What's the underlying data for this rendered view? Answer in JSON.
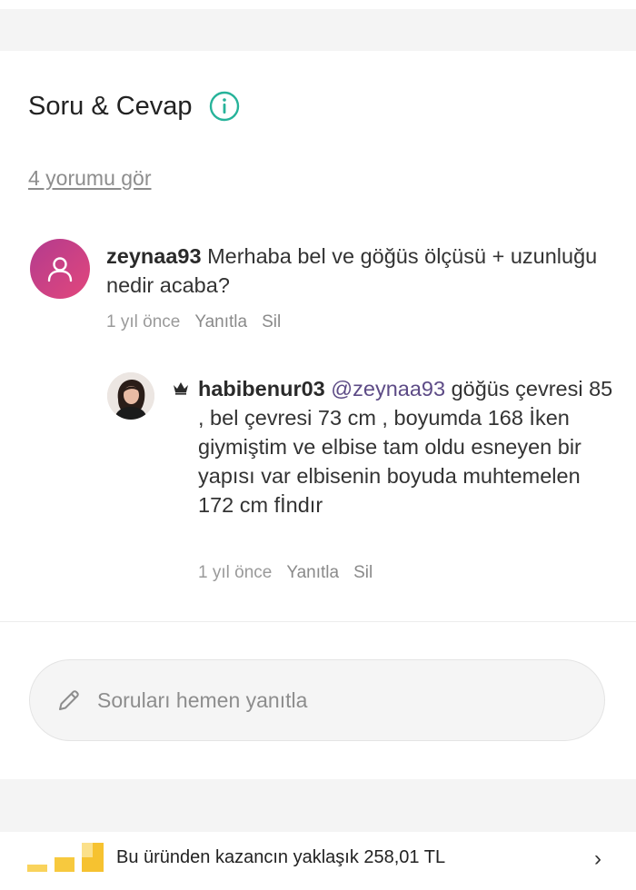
{
  "section": {
    "title": "Soru & Cevap",
    "see_all_link": "4 yorumu gör"
  },
  "comments": [
    {
      "username": "zeynaa93",
      "text": "Merhaba bel ve göğüs ölçüsü + uzunluğu nedir acaba?",
      "time": "1 yıl önce",
      "reply_label": "Yanıtla",
      "delete_label": "Sil"
    },
    {
      "username": "habibenur03",
      "mention": "@zeynaa93",
      "text": "göğüs çevresi 85 , bel çevresi 73 cm , boyumda 168 İken giymiştim ve elbise tam oldu esneyen bir yapısı var elbisenin boyuda muhtemelen 172 cm fİndır",
      "time": "1 yıl önce",
      "reply_label": "Yanıtla",
      "delete_label": "Sil",
      "badge_icon": "crown-icon"
    }
  ],
  "reply_input": {
    "placeholder": "Soruları hemen yanıtla",
    "icon": "pencil-icon"
  },
  "earnings": {
    "text": "Bu üründen kazancın yaklaşık 258,01 TL",
    "icon": "bar-chart-icon",
    "accent_color": "#f6c230"
  },
  "colors": {
    "info_icon": "#27b39a",
    "avatar_gradient": [
      "#b33b8e",
      "#e2477c"
    ],
    "mention": "#5d4b86"
  }
}
